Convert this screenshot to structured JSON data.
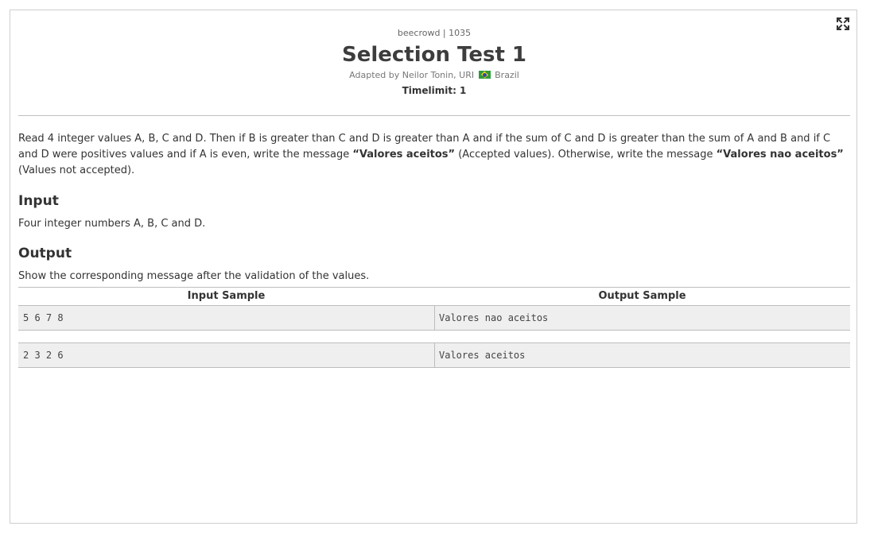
{
  "problem": {
    "category": "beecrowd | 1035",
    "title": "Selection Test 1",
    "adapted_prefix": "Adapted by Neilor Tonin, URI",
    "country": "Brazil",
    "timelimit": "Timelimit: 1",
    "expand_icon": "expand-icon"
  },
  "description": {
    "part1": "Read 4 integer values A, B, C and D. Then if B is greater than C and D is greater than A and if the sum of C and D is greater than the sum of A and B and if C and D were positives values and if A is even, write the message ",
    "accepted_msg": "“Valores aceitos”",
    "part2": " (Accepted values). Otherwise, write the message ",
    "not_accepted_msg": "“Valores nao aceitos”",
    "part3": " (Values not accepted)."
  },
  "input": {
    "title": "Input",
    "text": "Four integer numbers A, B, C and D."
  },
  "output": {
    "title": "Output",
    "text": "Show the corresponding message after the validation of the values."
  },
  "samples": {
    "input_header": "Input Sample",
    "output_header": "Output Sample",
    "rows": [
      {
        "input": "5 6 7 8",
        "output": "Valores nao aceitos"
      },
      {
        "input": "2 3 2 6",
        "output": "Valores aceitos"
      }
    ]
  },
  "colors": {
    "border": "#cfcfcf",
    "sample_bg": "#efefef",
    "text": "#333333"
  }
}
